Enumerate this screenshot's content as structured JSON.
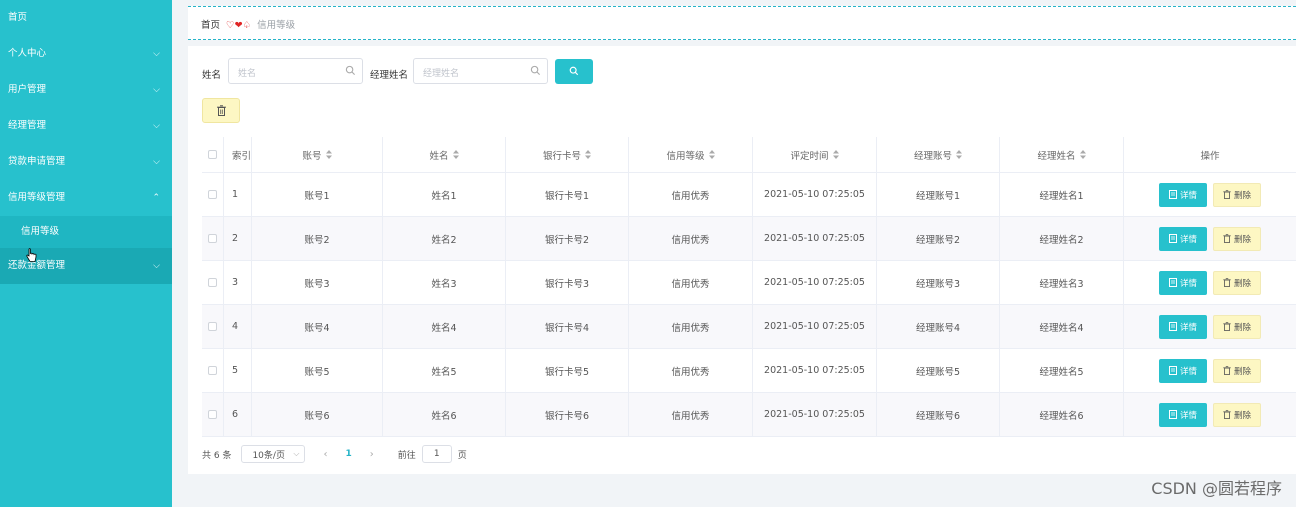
{
  "sidebar": {
    "items": [
      {
        "label": "首页"
      },
      {
        "label": "个人中心"
      },
      {
        "label": "用户管理"
      },
      {
        "label": "经理管理"
      },
      {
        "label": "贷款申请管理"
      },
      {
        "label": "信用等级管理"
      },
      {
        "label": "信用等级"
      },
      {
        "label": "还款金额管理"
      }
    ]
  },
  "breadcrumb": {
    "home": "首页",
    "current": "信用等级"
  },
  "search": {
    "name_label": "姓名",
    "name_placeholder": "姓名",
    "manager_label": "经理姓名",
    "manager_placeholder": "经理姓名"
  },
  "table": {
    "headers": [
      "索引",
      "账号",
      "姓名",
      "银行卡号",
      "信用等级",
      "评定时间",
      "经理账号",
      "经理姓名",
      "操作"
    ],
    "rows": [
      [
        "1",
        "账号1",
        "姓名1",
        "银行卡号1",
        "信用优秀",
        "2021-05-10 07:25:05",
        "经理账号1",
        "经理姓名1"
      ],
      [
        "2",
        "账号2",
        "姓名2",
        "银行卡号2",
        "信用优秀",
        "2021-05-10 07:25:05",
        "经理账号2",
        "经理姓名2"
      ],
      [
        "3",
        "账号3",
        "姓名3",
        "银行卡号3",
        "信用优秀",
        "2021-05-10 07:25:05",
        "经理账号3",
        "经理姓名3"
      ],
      [
        "4",
        "账号4",
        "姓名4",
        "银行卡号4",
        "信用优秀",
        "2021-05-10 07:25:05",
        "经理账号4",
        "经理姓名4"
      ],
      [
        "5",
        "账号5",
        "姓名5",
        "银行卡号5",
        "信用优秀",
        "2021-05-10 07:25:05",
        "经理账号5",
        "经理姓名5"
      ],
      [
        "6",
        "账号6",
        "姓名6",
        "银行卡号6",
        "信用优秀",
        "2021-05-10 07:25:05",
        "经理账号6",
        "经理姓名6"
      ]
    ],
    "detail_label": "详情",
    "delete_label": "删除"
  },
  "pager": {
    "total": "共 6 条",
    "page_size": "10条/页",
    "current": "1",
    "goto": "前往",
    "goto_value": "1",
    "page": "页"
  },
  "watermark": "CSDN @圆若程序",
  "colors": {
    "accent": "#27c1cd",
    "danger_bg": "#fdf7c3"
  }
}
